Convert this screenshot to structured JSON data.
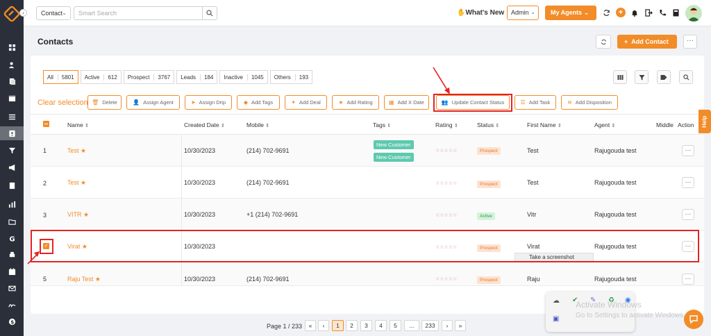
{
  "topbar": {
    "search_type": "Contact",
    "search_placeholder": "Smart Search",
    "whats_new": "What's New",
    "admin": "Admin",
    "my_agents": "My Agents"
  },
  "page": {
    "title": "Contacts",
    "add_contact": "Add Contact"
  },
  "filters": [
    {
      "label": "All",
      "count": "5801"
    },
    {
      "label": "Active",
      "count": "612"
    },
    {
      "label": "Prospect",
      "count": "3767"
    },
    {
      "label": "Leads",
      "count": "184"
    },
    {
      "label": "Inactive",
      "count": "1045"
    },
    {
      "label": "Others",
      "count": "193"
    }
  ],
  "bulk": {
    "clear_selection": "Clear selection",
    "actions": [
      "Delete",
      "Assign Agent",
      "Assign Drip",
      "Add Tags",
      "Add Deal",
      "Add Rating",
      "Add X Date",
      "Update Contact Status",
      "Add Task",
      "Add Disposition"
    ]
  },
  "table": {
    "headers": [
      "Name",
      "Created Date",
      "Mobile",
      "Tags",
      "Rating",
      "Status",
      "First Name",
      "Agent",
      "Middle",
      "Action"
    ],
    "rows": [
      {
        "num": "1",
        "name": "Test",
        "created": "10/30/2023",
        "mobile": "(214) 702-9691",
        "tags": [
          "New Customer",
          "New Customer"
        ],
        "status": "Prospect",
        "first_name": "Test",
        "agent": "Rajugouda test"
      },
      {
        "num": "2",
        "name": "Test",
        "created": "10/30/2023",
        "mobile": "(214) 702-9691",
        "tags": [],
        "status": "Prospect",
        "first_name": "Test",
        "agent": "Rajugouda test"
      },
      {
        "num": "3",
        "name": "VITR",
        "created": "10/30/2023",
        "mobile": "+1 (214) 702-9691",
        "tags": [],
        "status": "Active",
        "first_name": "Vitr",
        "agent": "Rajugouda test"
      },
      {
        "num": "",
        "name": "Virat",
        "created": "10/30/2023",
        "mobile": "",
        "tags": [],
        "status": "Prospect",
        "first_name": "Virat",
        "agent": "Rajugouda test"
      },
      {
        "num": "5",
        "name": "Raju Test",
        "created": "10/30/2023",
        "mobile": "(214) 702-9691",
        "tags": [],
        "status": "Prospect",
        "first_name": "Raju",
        "agent": "Rajugouda test"
      }
    ],
    "rating_stars": "☆☆☆☆☆",
    "more": "···"
  },
  "tooltip": "Take a screenshot",
  "pagination": {
    "info": "Page 1 / 233",
    "first": "«",
    "prev": "‹",
    "pages": [
      "1",
      "2",
      "3",
      "4",
      "5",
      "...",
      "233"
    ],
    "next": "›",
    "last": "»"
  },
  "help": "Help",
  "watermark": {
    "line1": "Activate Windows",
    "line2": "Go to Settings to activate Windows."
  },
  "colors": {
    "accent": "#f28c28",
    "annotation": "#e32323",
    "sidebar": "#2b2f3a"
  }
}
